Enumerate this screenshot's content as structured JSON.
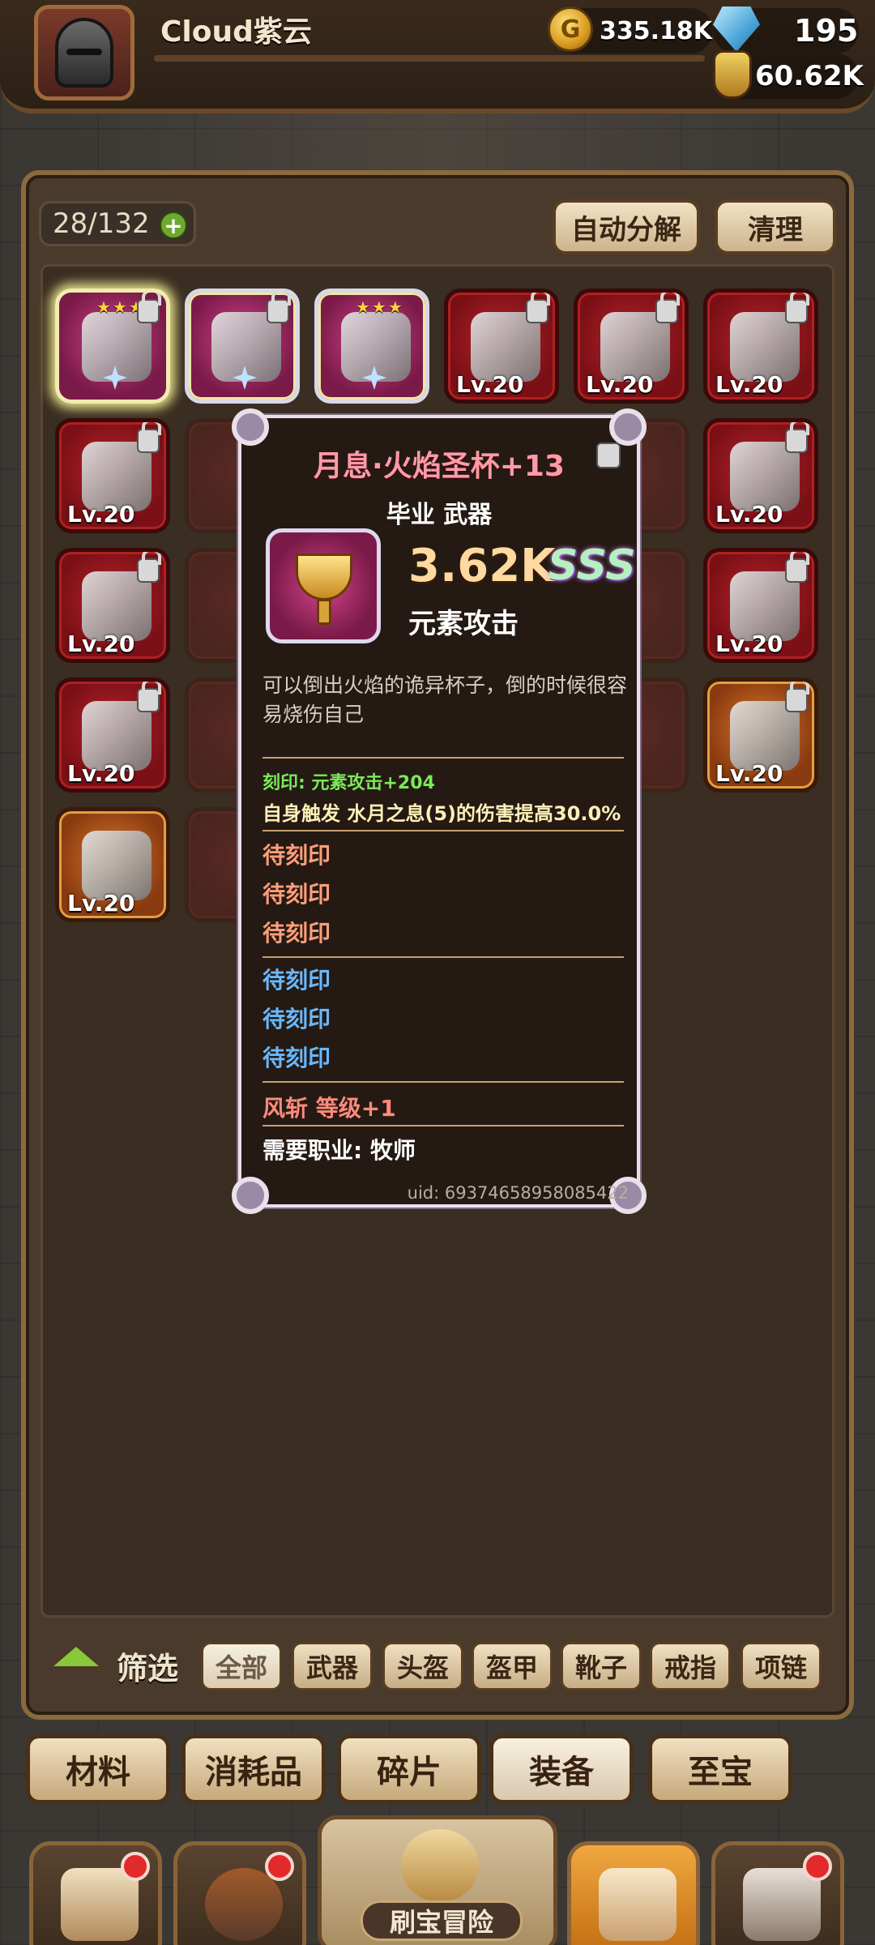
{
  "player": {
    "name": "Cloud紫云"
  },
  "resources": {
    "gold": "335.18K",
    "gold_symbol": "G",
    "gems": "195",
    "potion": "60.62K"
  },
  "inventory": {
    "count": "28/132",
    "plus": "+",
    "auto_decompose": "自动分解",
    "clear": "清理"
  },
  "slots": [
    {
      "level": "",
      "frame": "pink",
      "icon": "golden-chalice-icon",
      "locked": true,
      "stars": "★★★",
      "selected": true
    },
    {
      "level": "",
      "frame": "pink",
      "icon": "golden-chalice-icon",
      "locked": true,
      "stars": "",
      "selected": false
    },
    {
      "level": "",
      "frame": "pink",
      "icon": "armor-icon",
      "locked": false,
      "stars": "★★★",
      "selected": false
    },
    {
      "level": "Lv.20",
      "frame": "red",
      "icon": "shield-icon",
      "locked": true,
      "stars": ""
    },
    {
      "level": "Lv.20",
      "frame": "red",
      "icon": "flame-sword-icon",
      "locked": true,
      "stars": ""
    },
    {
      "level": "Lv.20",
      "frame": "red",
      "icon": "fish-icon",
      "locked": true,
      "stars": ""
    },
    {
      "level": "Lv.20",
      "frame": "red",
      "icon": "sword-icon",
      "locked": true,
      "stars": ""
    },
    {
      "level": "Lv.20",
      "frame": "red",
      "icon": "gingerbread-icon",
      "locked": true,
      "stars": ""
    },
    {
      "level": "Lv.20",
      "frame": "red",
      "icon": "helmet-icon",
      "locked": true,
      "stars": ""
    },
    {
      "level": "Lv.20",
      "frame": "red",
      "icon": "ring-icon",
      "locked": true,
      "stars": ""
    },
    {
      "level": "Lv.20",
      "frame": "red",
      "icon": "spiked-ring-icon",
      "locked": true,
      "stars": ""
    },
    {
      "level": "Lv.20",
      "frame": "orange",
      "icon": "gold-ring-icon",
      "locked": true,
      "stars": ""
    },
    {
      "level": "Lv.20",
      "frame": "orange",
      "icon": "gem-ring-icon",
      "locked": false,
      "stars": ""
    }
  ],
  "tooltip": {
    "title": "月息·火焰圣杯+13",
    "subtitle": "毕业 武器",
    "power": "3.62K",
    "grade": "SSS",
    "stat_type": "元素攻击",
    "description": "可以倒出火焰的诡异杯子，倒的时候很容易烧伤自己",
    "engrave": "刻印: 元素攻击+204",
    "effect": "自身触发 水月之息(5)的伤害提高30.0%",
    "pending_orange": [
      "待刻印",
      "待刻印",
      "待刻印"
    ],
    "pending_blue": [
      "待刻印",
      "待刻印",
      "待刻印"
    ],
    "skill": "风斩 等级+1",
    "job": "需要职业: 牧师",
    "uid": "uid: 69374658958085422"
  },
  "filter": {
    "label": "筛选",
    "tabs": [
      "全部",
      "武器",
      "头盔",
      "盔甲",
      "靴子",
      "戒指",
      "项链"
    ],
    "active": 0
  },
  "categories": {
    "tabs": [
      "材料",
      "消耗品",
      "碎片",
      "装备",
      "至宝"
    ],
    "active": 3
  },
  "nav": {
    "main_label": "刷宝冒险"
  },
  "colors": {
    "accent_gold": "#ffd9a0",
    "title_pink": "#ff9aa6",
    "engrave_green": "#7aea5a",
    "pending_orange": "#ff9e7a",
    "pending_blue": "#6ab8ff"
  }
}
